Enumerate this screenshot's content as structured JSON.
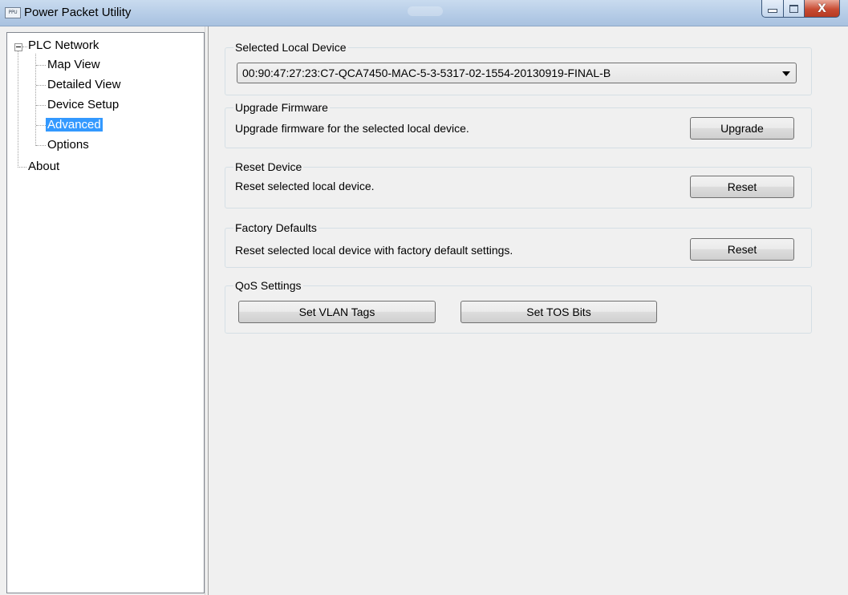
{
  "window": {
    "title": "Power Packet Utility",
    "icon_text": "PPU",
    "close_glyph": "X"
  },
  "tree": {
    "root": "PLC Network",
    "children": [
      "Map View",
      "Detailed View",
      "Device Setup",
      "Advanced",
      "Options"
    ],
    "about": "About",
    "selected": "Advanced"
  },
  "selected_device": {
    "legend": "Selected Local Device",
    "value": "00:90:47:27:23:C7-QCA7450-MAC-5-3-5317-02-1554-20130919-FINAL-B"
  },
  "upgrade_firmware": {
    "legend": "Upgrade Firmware",
    "description": "Upgrade firmware for the selected local device.",
    "button": "Upgrade"
  },
  "reset_device": {
    "legend": "Reset Device",
    "description": "Reset selected local device.",
    "button": "Reset"
  },
  "factory_defaults": {
    "legend": "Factory Defaults",
    "description": "Reset selected local device with factory default settings.",
    "button": "Reset"
  },
  "qos": {
    "legend": "QoS Settings",
    "vlan_button": "Set VLAN Tags",
    "tos_button": "Set TOS Bits"
  },
  "colors": {
    "selection": "#3399ff",
    "close_button": "#c84b33"
  }
}
